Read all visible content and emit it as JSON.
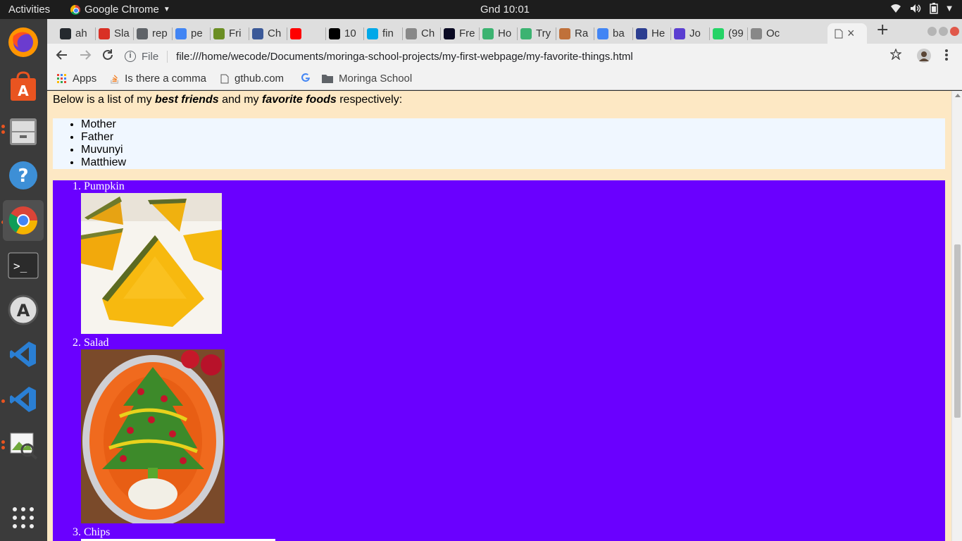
{
  "topbar": {
    "activities": "Activities",
    "app_name": "Google Chrome",
    "clock": "Gnd 10:01"
  },
  "dock": {
    "items": [
      "firefox",
      "software-center",
      "files",
      "help",
      "chrome",
      "terminal",
      "software-updater",
      "vscode",
      "vscode",
      "image-viewer",
      "show-apps"
    ]
  },
  "tabs": [
    {
      "label": "ah",
      "icon": "github-icon",
      "color": "#24292e"
    },
    {
      "label": "Sla",
      "icon": "gmail-icon",
      "color": "#d93025"
    },
    {
      "label": "rep",
      "icon": "repl-icon",
      "color": "#5f6368"
    },
    {
      "label": "pe",
      "icon": "google-icon",
      "color": "#4285f4"
    },
    {
      "label": "Fri",
      "icon": "chain-icon",
      "color": "#6b8e23"
    },
    {
      "label": "Ch",
      "icon": "ch-icon",
      "color": "#3b5998"
    },
    {
      "label": "",
      "icon": "youtube-icon",
      "color": "#ff0000"
    },
    {
      "label": "10",
      "icon": "medium-icon",
      "color": "#000000"
    },
    {
      "label": "fin",
      "icon": "m-icon",
      "color": "#00a8e8"
    },
    {
      "label": "Ch",
      "icon": "page-icon",
      "color": "#888888"
    },
    {
      "label": "Fre",
      "icon": "fcc-icon",
      "color": "#0a0a23"
    },
    {
      "label": "Ho",
      "icon": "chart-icon",
      "color": "#3cb371"
    },
    {
      "label": "Try",
      "icon": "chart-icon",
      "color": "#3cb371"
    },
    {
      "label": "Ra",
      "icon": "box-icon",
      "color": "#c0713a"
    },
    {
      "label": "ba",
      "icon": "google-icon",
      "color": "#4285f4"
    },
    {
      "label": "He",
      "icon": "h-icon",
      "color": "#2c3e91"
    },
    {
      "label": "Jo",
      "icon": "circle-icon",
      "color": "#5b3fd1"
    },
    {
      "label": "(99",
      "icon": "whatsapp-icon",
      "color": "#25d366"
    },
    {
      "label": "Oc",
      "icon": "page-icon",
      "color": "#888888"
    }
  ],
  "active_tab": {
    "label": "",
    "close": "×"
  },
  "new_tab": "+",
  "toolbar": {
    "scheme": "File",
    "url": "file:///home/wecode/Documents/moringa-school-projects/my-first-webpage/my-favorite-things.html"
  },
  "bookmarks": [
    {
      "label": "Apps",
      "icon": "apps-grid-icon"
    },
    {
      "label": "Is there a comma",
      "icon": "stack-icon"
    },
    {
      "label": "gthub.com",
      "icon": "page-icon"
    },
    {
      "label": "",
      "icon": "google-icon"
    },
    {
      "label": "Moringa School",
      "icon": "folder-icon"
    }
  ],
  "page": {
    "intro_pre": "Below is a list of my ",
    "intro_em1": "best friends",
    "intro_mid": " and my ",
    "intro_em2": "favorite foods",
    "intro_post": " respectively:",
    "friends": [
      "Mother",
      "Father",
      "Muvunyi",
      "Matthiew"
    ],
    "foods": [
      {
        "num": "1.",
        "name": "Pumpkin"
      },
      {
        "num": "2.",
        "name": "Salad"
      },
      {
        "num": "3.",
        "name": "Chips"
      }
    ]
  },
  "colors": {
    "page_bg": "#fde8c4",
    "friends_bg": "#f0f7ff",
    "foods_bg": "#6a00ff"
  }
}
